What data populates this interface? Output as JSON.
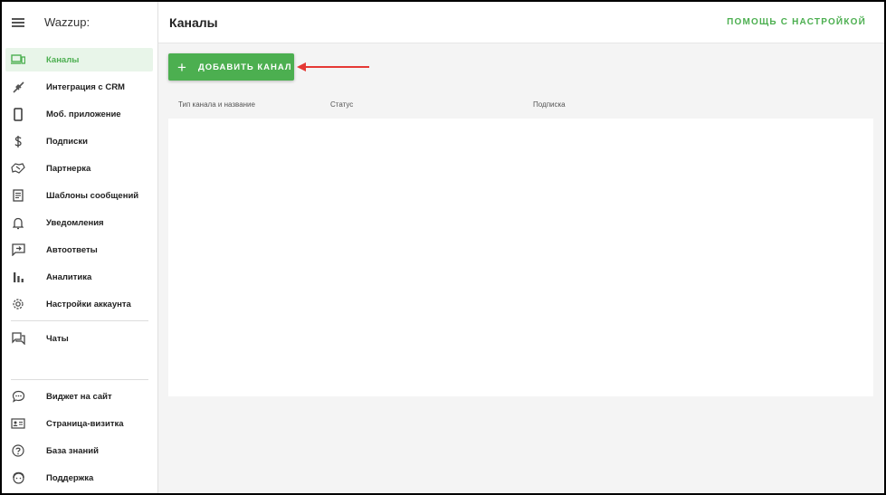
{
  "app": {
    "logo": "Wazzup:"
  },
  "header": {
    "title": "Каналы",
    "help_link": "ПОМОЩЬ С НАСТРОЙКОЙ"
  },
  "sidebar": {
    "items": [
      {
        "label": "Каналы",
        "icon": "devices-icon",
        "active": true
      },
      {
        "label": "Интеграция с CRM",
        "icon": "plug-icon"
      },
      {
        "label": "Моб. приложение",
        "icon": "smartphone-icon"
      },
      {
        "label": "Подписки",
        "icon": "dollar-icon"
      },
      {
        "label": "Партнерка",
        "icon": "handshake-icon"
      },
      {
        "label": "Шаблоны сообщений",
        "icon": "document-icon"
      },
      {
        "label": "Уведомления",
        "icon": "bell-icon"
      },
      {
        "label": "Автоответы",
        "icon": "auto-reply-icon"
      },
      {
        "label": "Аналитика",
        "icon": "bar-chart-icon"
      },
      {
        "label": "Настройки аккаунта",
        "icon": "gear-icon"
      },
      {
        "label": "Чаты",
        "icon": "chat-icon"
      }
    ],
    "bottom_items": [
      {
        "label": "Виджет на сайт",
        "icon": "chat-bubble-icon"
      },
      {
        "label": "Страница-визитка",
        "icon": "id-card-icon"
      },
      {
        "label": "База знаний",
        "icon": "help-circle-icon"
      },
      {
        "label": "Поддержка",
        "icon": "support-face-icon"
      }
    ]
  },
  "main": {
    "add_button": {
      "label": "ДОБАВИТЬ КАНАЛ",
      "icon": "plus-icon"
    },
    "table": {
      "columns": [
        "Тип канала и название",
        "Статус",
        "Подписка"
      ]
    }
  },
  "annotation": {
    "arrow_color": "#e53935"
  },
  "colors": {
    "accent": "#4caf50",
    "active_bg": "#e8f5e9",
    "content_bg": "#f4f4f4"
  }
}
